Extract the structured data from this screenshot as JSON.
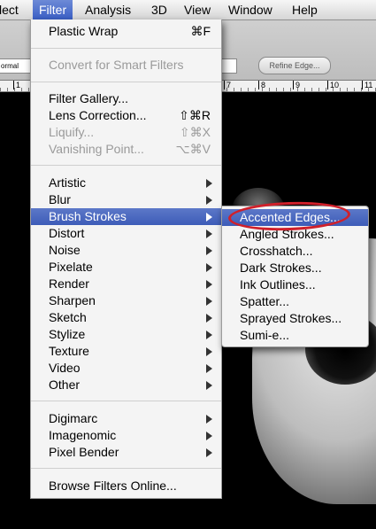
{
  "menubar": {
    "items": [
      "lect",
      "Filter",
      "Analysis",
      "3D",
      "View",
      "Window",
      "Help"
    ]
  },
  "options_bar": {
    "style_value": "ormal",
    "refine_edge_label": "Refine Edge..."
  },
  "ruler": {
    "numbers": [
      "1",
      "7",
      "8",
      "9",
      "10",
      "11"
    ]
  },
  "filter_menu": {
    "last_filter": {
      "label": "Plastic Wrap",
      "shortcut": "⌘F"
    },
    "convert_smart": {
      "label": "Convert for Smart Filters"
    },
    "filter_gallery": {
      "label": "Filter Gallery..."
    },
    "lens_correction": {
      "label": "Lens Correction...",
      "shortcut": "⇧⌘R"
    },
    "liquify": {
      "label": "Liquify...",
      "shortcut": "⇧⌘X"
    },
    "vanishing_point": {
      "label": "Vanishing Point...",
      "shortcut": "⌥⌘V"
    },
    "categories": [
      "Artistic",
      "Blur",
      "Brush Strokes",
      "Distort",
      "Noise",
      "Pixelate",
      "Render",
      "Sharpen",
      "Sketch",
      "Stylize",
      "Texture",
      "Video",
      "Other"
    ],
    "plugins": [
      "Digimarc",
      "Imagenomic",
      "Pixel Bender"
    ],
    "browse_online": {
      "label": "Browse Filters Online..."
    }
  },
  "brush_strokes_submenu": {
    "items": [
      "Accented Edges...",
      "Angled Strokes...",
      "Crosshatch...",
      "Dark Strokes...",
      "Ink Outlines...",
      "Spatter...",
      "Sprayed Strokes...",
      "Sumi-e..."
    ]
  }
}
